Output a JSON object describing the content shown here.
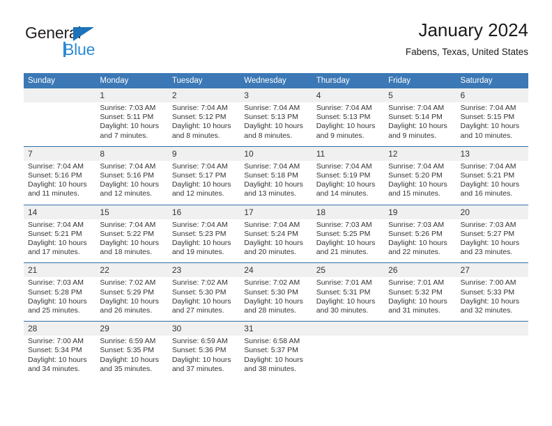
{
  "brand": {
    "name_dark": "General",
    "name_blue": "Blue",
    "accent_color": "#1c72bb",
    "accent_light": "#2b8ad6",
    "triangle_icon": "triangle-icon"
  },
  "header": {
    "title": "January 2024",
    "subtitle": "Fabens, Texas, United States"
  },
  "colors": {
    "header_row_bg": "#3b78b5",
    "daynum_bg": "#f0f0f0",
    "separator": "#2e6da4",
    "text": "#333333"
  },
  "weekdays": [
    "Sunday",
    "Monday",
    "Tuesday",
    "Wednesday",
    "Thursday",
    "Friday",
    "Saturday"
  ],
  "weeks": [
    {
      "days": [
        {
          "num": "",
          "sunrise": "",
          "sunset": "",
          "daylight1": "",
          "daylight2": ""
        },
        {
          "num": "1",
          "sunrise": "Sunrise: 7:03 AM",
          "sunset": "Sunset: 5:11 PM",
          "daylight1": "Daylight: 10 hours",
          "daylight2": "and 7 minutes."
        },
        {
          "num": "2",
          "sunrise": "Sunrise: 7:04 AM",
          "sunset": "Sunset: 5:12 PM",
          "daylight1": "Daylight: 10 hours",
          "daylight2": "and 8 minutes."
        },
        {
          "num": "3",
          "sunrise": "Sunrise: 7:04 AM",
          "sunset": "Sunset: 5:13 PM",
          "daylight1": "Daylight: 10 hours",
          "daylight2": "and 8 minutes."
        },
        {
          "num": "4",
          "sunrise": "Sunrise: 7:04 AM",
          "sunset": "Sunset: 5:13 PM",
          "daylight1": "Daylight: 10 hours",
          "daylight2": "and 9 minutes."
        },
        {
          "num": "5",
          "sunrise": "Sunrise: 7:04 AM",
          "sunset": "Sunset: 5:14 PM",
          "daylight1": "Daylight: 10 hours",
          "daylight2": "and 9 minutes."
        },
        {
          "num": "6",
          "sunrise": "Sunrise: 7:04 AM",
          "sunset": "Sunset: 5:15 PM",
          "daylight1": "Daylight: 10 hours",
          "daylight2": "and 10 minutes."
        }
      ]
    },
    {
      "days": [
        {
          "num": "7",
          "sunrise": "Sunrise: 7:04 AM",
          "sunset": "Sunset: 5:16 PM",
          "daylight1": "Daylight: 10 hours",
          "daylight2": "and 11 minutes."
        },
        {
          "num": "8",
          "sunrise": "Sunrise: 7:04 AM",
          "sunset": "Sunset: 5:16 PM",
          "daylight1": "Daylight: 10 hours",
          "daylight2": "and 12 minutes."
        },
        {
          "num": "9",
          "sunrise": "Sunrise: 7:04 AM",
          "sunset": "Sunset: 5:17 PM",
          "daylight1": "Daylight: 10 hours",
          "daylight2": "and 12 minutes."
        },
        {
          "num": "10",
          "sunrise": "Sunrise: 7:04 AM",
          "sunset": "Sunset: 5:18 PM",
          "daylight1": "Daylight: 10 hours",
          "daylight2": "and 13 minutes."
        },
        {
          "num": "11",
          "sunrise": "Sunrise: 7:04 AM",
          "sunset": "Sunset: 5:19 PM",
          "daylight1": "Daylight: 10 hours",
          "daylight2": "and 14 minutes."
        },
        {
          "num": "12",
          "sunrise": "Sunrise: 7:04 AM",
          "sunset": "Sunset: 5:20 PM",
          "daylight1": "Daylight: 10 hours",
          "daylight2": "and 15 minutes."
        },
        {
          "num": "13",
          "sunrise": "Sunrise: 7:04 AM",
          "sunset": "Sunset: 5:21 PM",
          "daylight1": "Daylight: 10 hours",
          "daylight2": "and 16 minutes."
        }
      ]
    },
    {
      "days": [
        {
          "num": "14",
          "sunrise": "Sunrise: 7:04 AM",
          "sunset": "Sunset: 5:21 PM",
          "daylight1": "Daylight: 10 hours",
          "daylight2": "and 17 minutes."
        },
        {
          "num": "15",
          "sunrise": "Sunrise: 7:04 AM",
          "sunset": "Sunset: 5:22 PM",
          "daylight1": "Daylight: 10 hours",
          "daylight2": "and 18 minutes."
        },
        {
          "num": "16",
          "sunrise": "Sunrise: 7:04 AM",
          "sunset": "Sunset: 5:23 PM",
          "daylight1": "Daylight: 10 hours",
          "daylight2": "and 19 minutes."
        },
        {
          "num": "17",
          "sunrise": "Sunrise: 7:04 AM",
          "sunset": "Sunset: 5:24 PM",
          "daylight1": "Daylight: 10 hours",
          "daylight2": "and 20 minutes."
        },
        {
          "num": "18",
          "sunrise": "Sunrise: 7:03 AM",
          "sunset": "Sunset: 5:25 PM",
          "daylight1": "Daylight: 10 hours",
          "daylight2": "and 21 minutes."
        },
        {
          "num": "19",
          "sunrise": "Sunrise: 7:03 AM",
          "sunset": "Sunset: 5:26 PM",
          "daylight1": "Daylight: 10 hours",
          "daylight2": "and 22 minutes."
        },
        {
          "num": "20",
          "sunrise": "Sunrise: 7:03 AM",
          "sunset": "Sunset: 5:27 PM",
          "daylight1": "Daylight: 10 hours",
          "daylight2": "and 23 minutes."
        }
      ]
    },
    {
      "days": [
        {
          "num": "21",
          "sunrise": "Sunrise: 7:03 AM",
          "sunset": "Sunset: 5:28 PM",
          "daylight1": "Daylight: 10 hours",
          "daylight2": "and 25 minutes."
        },
        {
          "num": "22",
          "sunrise": "Sunrise: 7:02 AM",
          "sunset": "Sunset: 5:29 PM",
          "daylight1": "Daylight: 10 hours",
          "daylight2": "and 26 minutes."
        },
        {
          "num": "23",
          "sunrise": "Sunrise: 7:02 AM",
          "sunset": "Sunset: 5:30 PM",
          "daylight1": "Daylight: 10 hours",
          "daylight2": "and 27 minutes."
        },
        {
          "num": "24",
          "sunrise": "Sunrise: 7:02 AM",
          "sunset": "Sunset: 5:30 PM",
          "daylight1": "Daylight: 10 hours",
          "daylight2": "and 28 minutes."
        },
        {
          "num": "25",
          "sunrise": "Sunrise: 7:01 AM",
          "sunset": "Sunset: 5:31 PM",
          "daylight1": "Daylight: 10 hours",
          "daylight2": "and 30 minutes."
        },
        {
          "num": "26",
          "sunrise": "Sunrise: 7:01 AM",
          "sunset": "Sunset: 5:32 PM",
          "daylight1": "Daylight: 10 hours",
          "daylight2": "and 31 minutes."
        },
        {
          "num": "27",
          "sunrise": "Sunrise: 7:00 AM",
          "sunset": "Sunset: 5:33 PM",
          "daylight1": "Daylight: 10 hours",
          "daylight2": "and 32 minutes."
        }
      ]
    },
    {
      "days": [
        {
          "num": "28",
          "sunrise": "Sunrise: 7:00 AM",
          "sunset": "Sunset: 5:34 PM",
          "daylight1": "Daylight: 10 hours",
          "daylight2": "and 34 minutes."
        },
        {
          "num": "29",
          "sunrise": "Sunrise: 6:59 AM",
          "sunset": "Sunset: 5:35 PM",
          "daylight1": "Daylight: 10 hours",
          "daylight2": "and 35 minutes."
        },
        {
          "num": "30",
          "sunrise": "Sunrise: 6:59 AM",
          "sunset": "Sunset: 5:36 PM",
          "daylight1": "Daylight: 10 hours",
          "daylight2": "and 37 minutes."
        },
        {
          "num": "31",
          "sunrise": "Sunrise: 6:58 AM",
          "sunset": "Sunset: 5:37 PM",
          "daylight1": "Daylight: 10 hours",
          "daylight2": "and 38 minutes."
        },
        {
          "num": "",
          "sunrise": "",
          "sunset": "",
          "daylight1": "",
          "daylight2": ""
        },
        {
          "num": "",
          "sunrise": "",
          "sunset": "",
          "daylight1": "",
          "daylight2": ""
        },
        {
          "num": "",
          "sunrise": "",
          "sunset": "",
          "daylight1": "",
          "daylight2": ""
        }
      ]
    }
  ]
}
